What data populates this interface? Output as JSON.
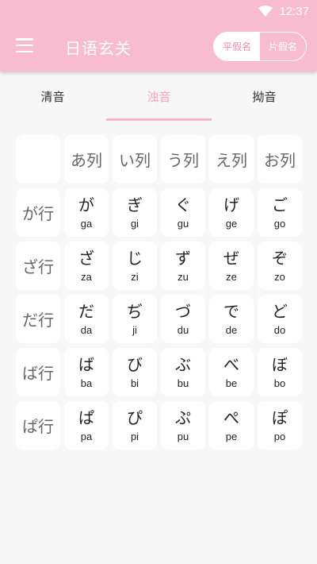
{
  "status": {
    "time": "12:37"
  },
  "appbar": {
    "title": "日语玄关",
    "toggle": [
      "平假名",
      "片假名"
    ]
  },
  "tabs": [
    "清音",
    "浊音",
    "拗音"
  ],
  "grid": {
    "columns": [
      "あ列",
      "い列",
      "う列",
      "え列",
      "お列"
    ],
    "rows": [
      {
        "label": "が行",
        "cells": [
          [
            "が",
            "ga"
          ],
          [
            "ぎ",
            "gi"
          ],
          [
            "ぐ",
            "gu"
          ],
          [
            "げ",
            "ge"
          ],
          [
            "ご",
            "go"
          ]
        ]
      },
      {
        "label": "ざ行",
        "cells": [
          [
            "ざ",
            "za"
          ],
          [
            "じ",
            "zi"
          ],
          [
            "ず",
            "zu"
          ],
          [
            "ぜ",
            "ze"
          ],
          [
            "ぞ",
            "zo"
          ]
        ]
      },
      {
        "label": "だ行",
        "cells": [
          [
            "だ",
            "da"
          ],
          [
            "ぢ",
            "ji"
          ],
          [
            "づ",
            "du"
          ],
          [
            "で",
            "de"
          ],
          [
            "ど",
            "do"
          ]
        ]
      },
      {
        "label": "ば行",
        "cells": [
          [
            "ば",
            "ba"
          ],
          [
            "び",
            "bi"
          ],
          [
            "ぶ",
            "bu"
          ],
          [
            "べ",
            "be"
          ],
          [
            "ぼ",
            "bo"
          ]
        ]
      },
      {
        "label": "ぱ行",
        "cells": [
          [
            "ぱ",
            "pa"
          ],
          [
            "ぴ",
            "pi"
          ],
          [
            "ぷ",
            "pu"
          ],
          [
            "ぺ",
            "pe"
          ],
          [
            "ぽ",
            "po"
          ]
        ]
      }
    ]
  }
}
